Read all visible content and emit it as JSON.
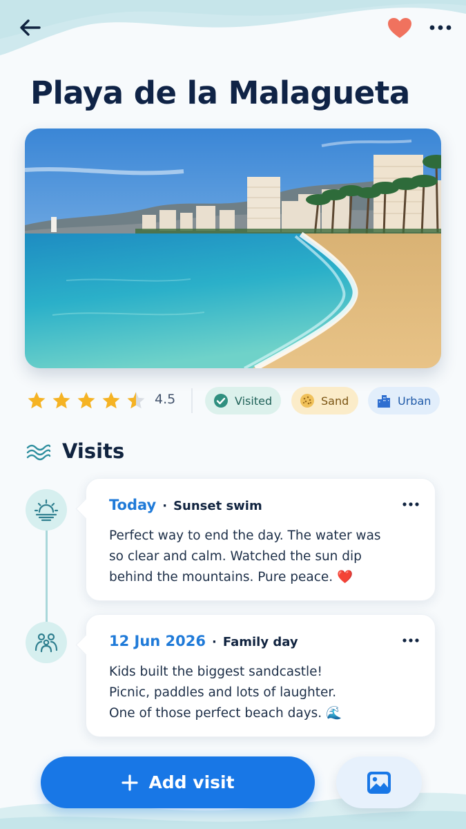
{
  "header": {
    "back_icon": "arrow-left-icon",
    "favorite_icon": "heart-icon",
    "more_icon": "more-horizontal-icon",
    "favorite_color": "#f0725e"
  },
  "place": {
    "title": "Playa de la Malagueta",
    "photo_alt": "Beach with turquoise sea, palm trees and city buildings",
    "rating": 4.5,
    "rating_label": "4.5",
    "star_color": "#f5b324"
  },
  "tags": [
    {
      "label": "Visited",
      "icon": "check-circle-icon",
      "color": "#1f6158",
      "bg": "#dcf1ec"
    },
    {
      "label": "Sand",
      "icon": "sand-icon",
      "color": "#7a5413",
      "bg": "#fbecc9"
    },
    {
      "label": "Urban",
      "icon": "city-buildings-icon",
      "color": "#1f5aa8",
      "bg": "#e2eefb"
    }
  ],
  "visits": {
    "title": "Visits",
    "icon": "waves-icon",
    "entries": [
      {
        "date": "Today",
        "label": "Sunset swim",
        "icon": "sunset-icon",
        "body_lines": [
          "Perfect way to end the day. The water was",
          "so clear and calm. Watched the sun dip",
          "behind the mountains. Pure peace. ❤️"
        ]
      },
      {
        "date": "12 Jun 2026",
        "label": "Family day",
        "icon": "family-icon",
        "body_lines": [
          "Kids built the biggest sandcastle!",
          "Picnic, paddles and lots of laughter.",
          "One of those perfect beach days. 🌊"
        ]
      }
    ]
  },
  "actions": {
    "add_visit_label": "Add visit",
    "add_icon": "plus-icon",
    "photo_icon": "image-icon",
    "accent": "#1877e6"
  }
}
